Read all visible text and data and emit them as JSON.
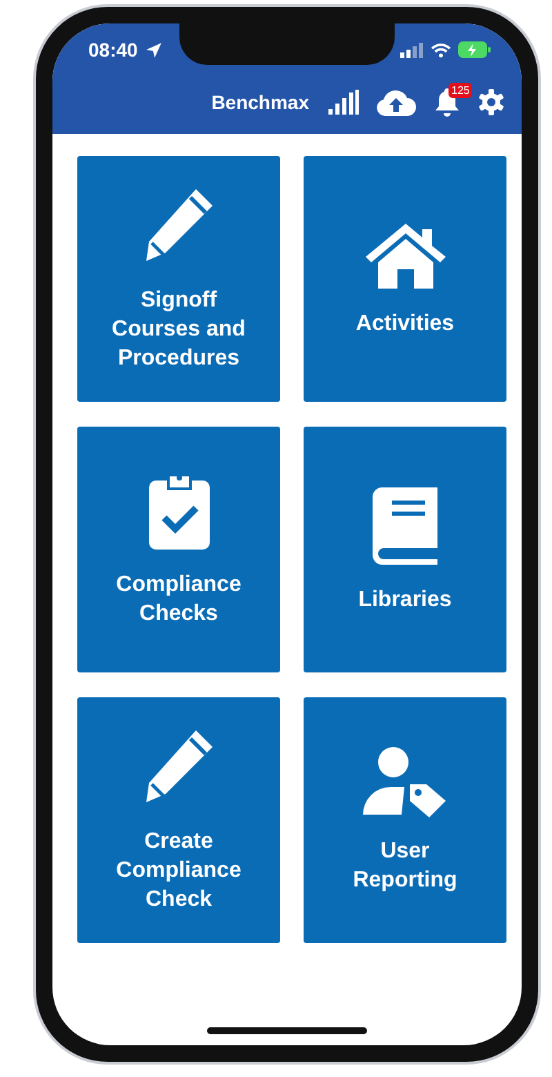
{
  "status_bar": {
    "time": "08:40"
  },
  "app_bar": {
    "title": "Benchmax",
    "notification_count": "125"
  },
  "tiles": [
    {
      "label": "Signoff Courses and Procedures",
      "kind": "pencil"
    },
    {
      "label": "Activities",
      "kind": "house"
    },
    {
      "label": "Compliance Checks",
      "kind": "clipboard"
    },
    {
      "label": "Libraries",
      "kind": "book"
    },
    {
      "label": "Create Compliance Check",
      "kind": "pencil"
    },
    {
      "label": "User Reporting",
      "kind": "user"
    }
  ]
}
